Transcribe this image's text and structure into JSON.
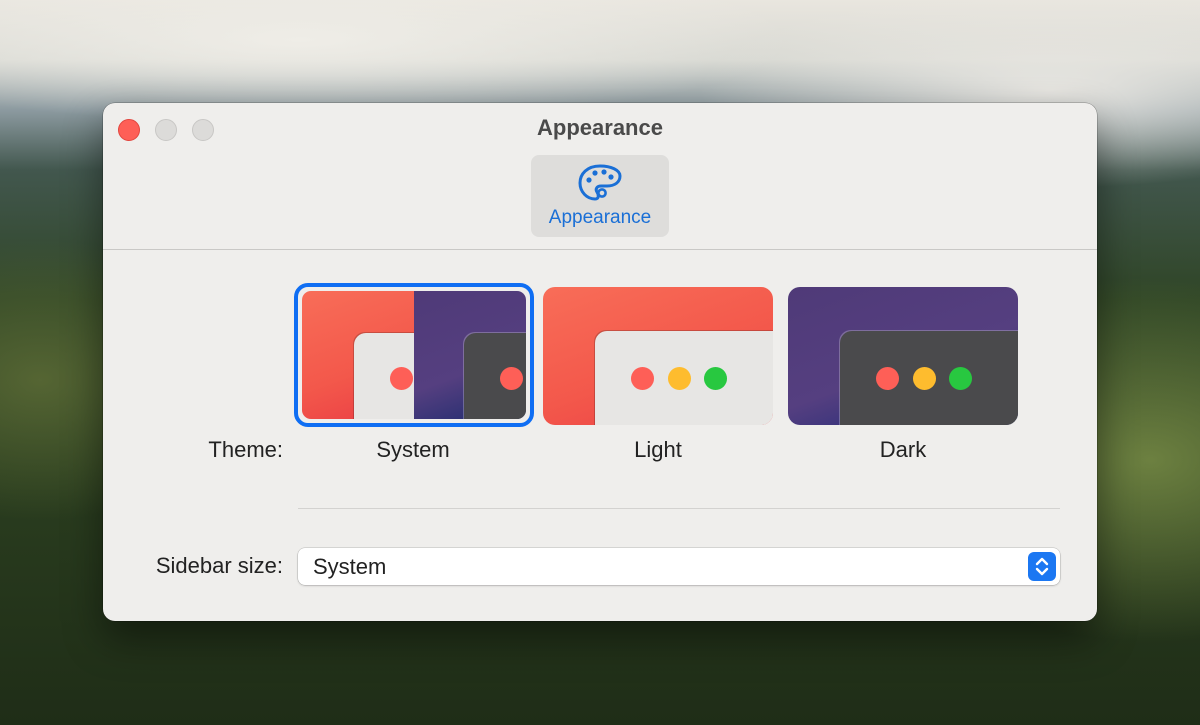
{
  "window": {
    "title": "Appearance"
  },
  "toolbar": {
    "tab_label": "Appearance",
    "tab_icon": "palette-icon",
    "accent": "#1a6fd6"
  },
  "theme": {
    "label": "Theme:",
    "options": [
      {
        "name": "System",
        "selected": true
      },
      {
        "name": "Light",
        "selected": false
      },
      {
        "name": "Dark",
        "selected": false
      }
    ]
  },
  "sidebar_size": {
    "label": "Sidebar size:",
    "value": "System"
  },
  "colors": {
    "selection": "#0f6ef3",
    "close": "#fe5f57",
    "minimize": "#febc2e",
    "zoom": "#28c840"
  }
}
